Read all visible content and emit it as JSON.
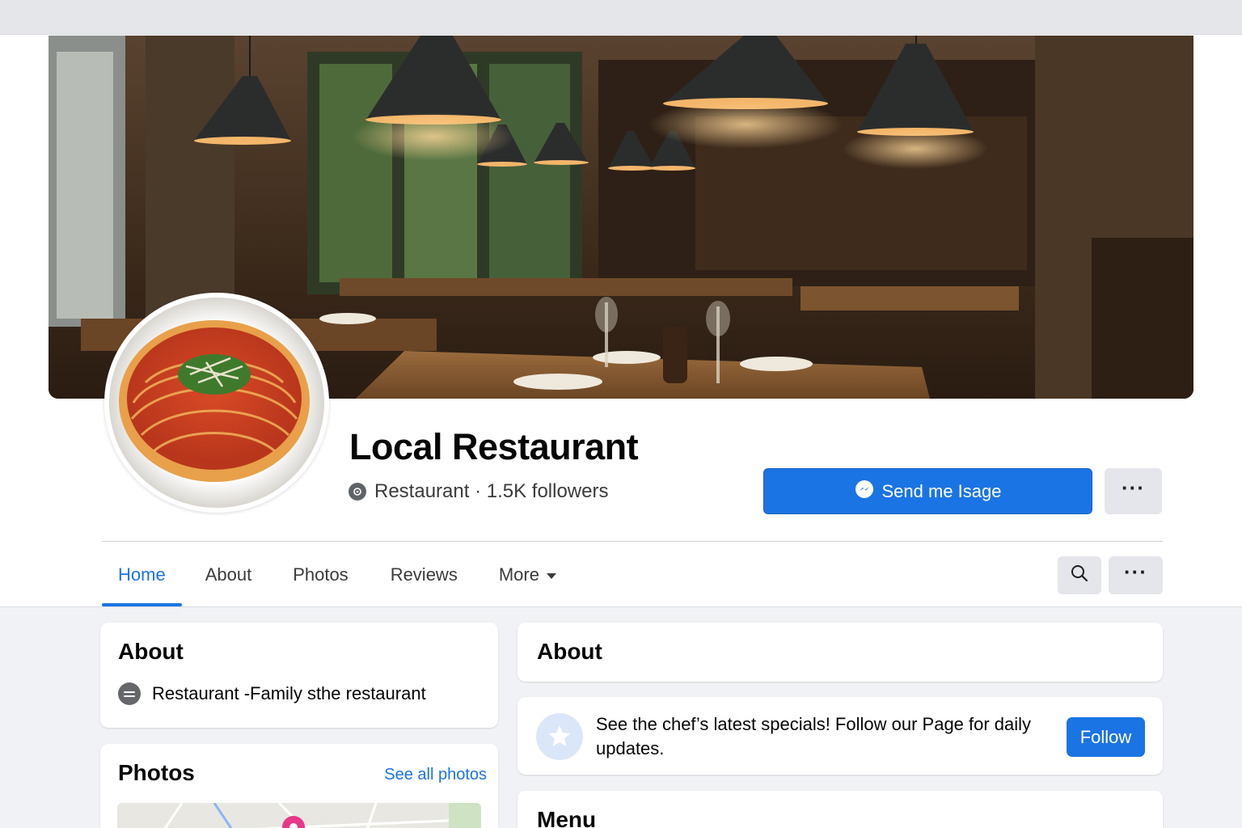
{
  "page": {
    "name": "Local Restaurant",
    "category": "Restaurant",
    "followers": "1.5K followers",
    "separator": " · "
  },
  "actions": {
    "send_message_label": "Send me Isage",
    "more_label": "···"
  },
  "tabs": [
    {
      "label": "Home",
      "active": true
    },
    {
      "label": "About",
      "active": false
    },
    {
      "label": "Photos",
      "active": false
    },
    {
      "label": "Reviews",
      "active": false
    },
    {
      "label": "More",
      "active": false,
      "dropdown": true
    }
  ],
  "about_card": {
    "title": "About",
    "detail": "Restaurant -Family sthe restaurant"
  },
  "photos_card": {
    "title": "Photos",
    "see_all": "See all photos"
  },
  "about_right": {
    "title": "About"
  },
  "follow_card": {
    "message": "See the chef’s latest specials!  Follow our Page for daily updates.",
    "button": "Follow"
  },
  "menu_card": {
    "title": "Menu"
  },
  "colors": {
    "accent": "#1b74e4",
    "button_gray": "#e4e6eb",
    "background": "#f0f2f5"
  }
}
